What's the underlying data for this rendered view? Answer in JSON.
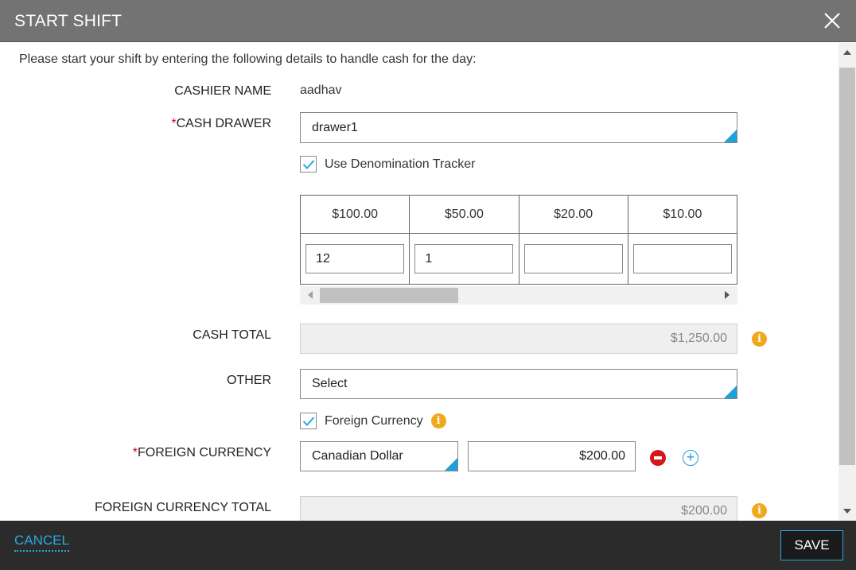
{
  "dialog": {
    "title": "START SHIFT"
  },
  "intro_text": "Please start your shift by entering the following details to handle cash for the day:",
  "cashier": {
    "label": "CASHIER NAME",
    "value": "aadhav"
  },
  "cash_drawer": {
    "required_mark": "*",
    "label": "CASH DRAWER",
    "value": "drawer1"
  },
  "denomination_tracker": {
    "label": "Use Denomination Tracker",
    "checked": true,
    "columns": [
      "$100.00",
      "$50.00",
      "$20.00",
      "$10.00"
    ],
    "counts": [
      "12",
      "1",
      "",
      ""
    ]
  },
  "cash_total": {
    "label": "CASH TOTAL",
    "value": "$1,250.00"
  },
  "other": {
    "label": "OTHER",
    "value": "Select"
  },
  "foreign_currency_toggle": {
    "label": "Foreign Currency",
    "checked": true
  },
  "foreign_currency": {
    "required_mark": "*",
    "label": "FOREIGN CURRENCY",
    "currency": "Canadian Dollar",
    "amount": "$200.00"
  },
  "foreign_currency_total": {
    "label": "FOREIGN CURRENCY TOTAL",
    "value": "$200.00"
  },
  "footer": {
    "cancel_label": "CANCEL",
    "save_label": "SAVE"
  },
  "colors": {
    "accent": "#29a9e0",
    "header_bg": "#737373",
    "footer_bg": "#2b2b2b",
    "required": "#d0021b",
    "info": "#f0a81c",
    "remove": "#d9141a"
  }
}
